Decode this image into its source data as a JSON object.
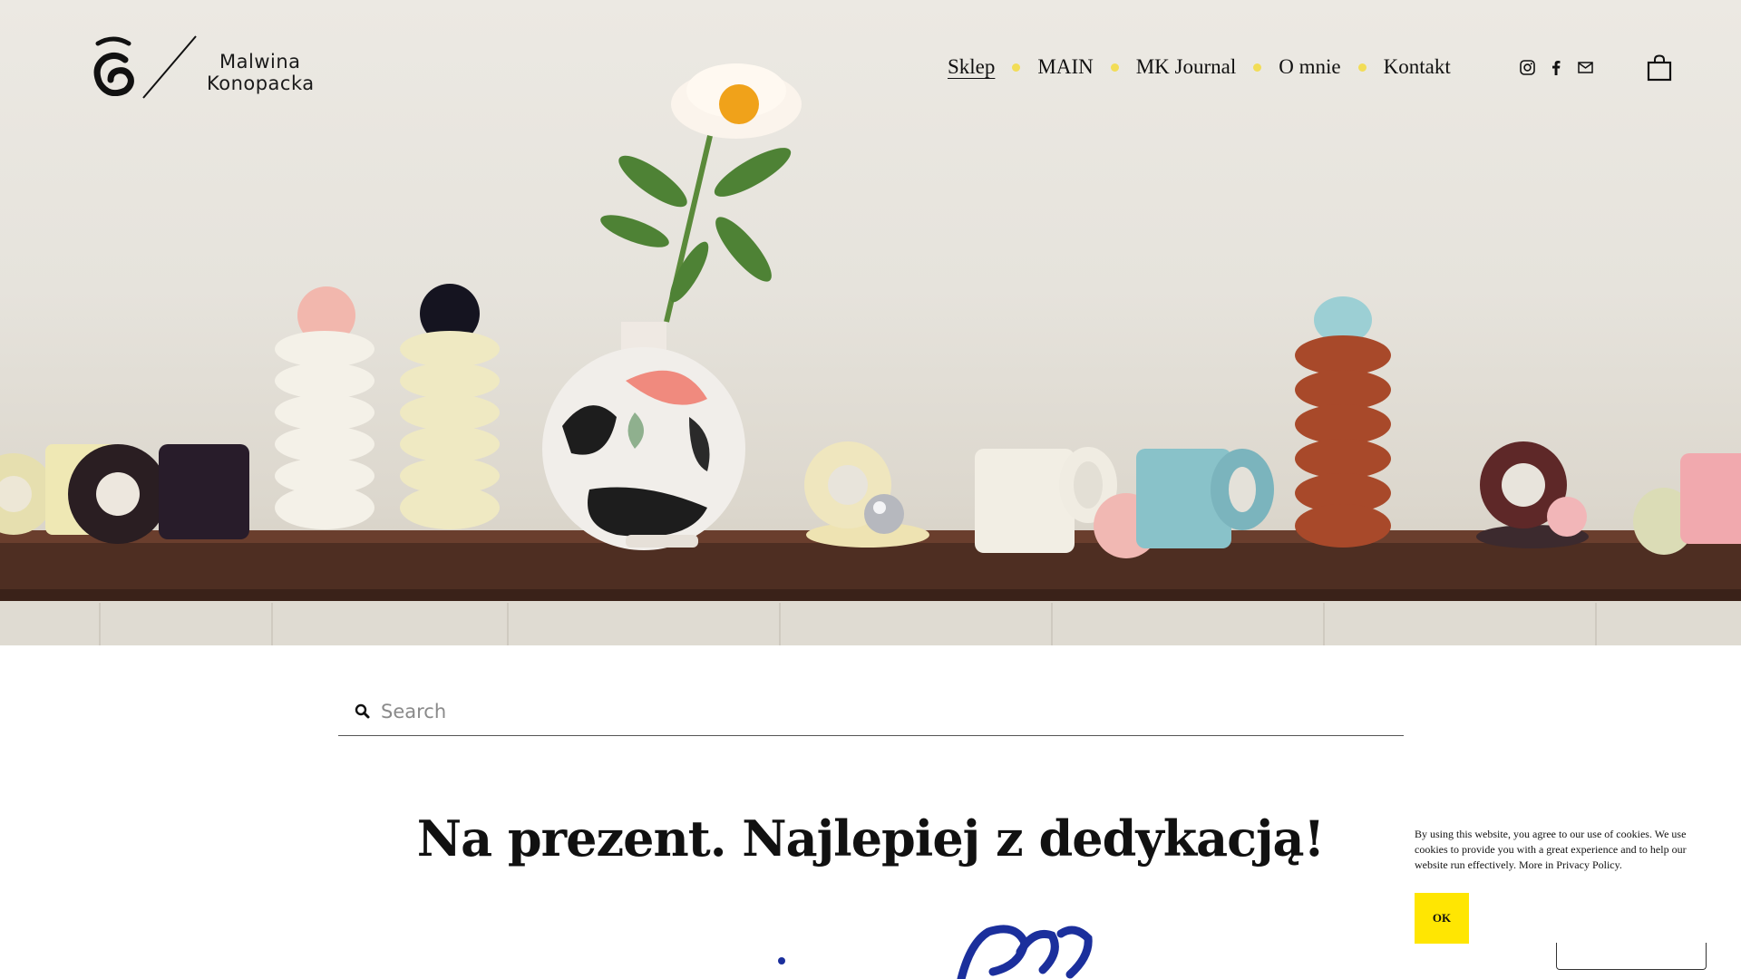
{
  "brand": {
    "line1": "Malwina",
    "line2": "Konopacka"
  },
  "nav": {
    "items": [
      {
        "label": "Sklep",
        "active": true
      },
      {
        "label": "MAIN"
      },
      {
        "label": "MK Journal"
      },
      {
        "label": "O mnie"
      },
      {
        "label": "Kontakt"
      }
    ]
  },
  "social": {
    "icons": [
      "instagram-icon",
      "facebook-icon",
      "mail-icon"
    ]
  },
  "cart": {
    "icon": "shopping-bag-icon"
  },
  "search": {
    "placeholder": "Search",
    "value": ""
  },
  "main": {
    "headline": "Na prezent. Najlepiej z dedykacją!"
  },
  "cookie": {
    "text": "By using this website, you agree to our use of cookies. We use cookies to provide you with a great experience and to help our website run effectively. More in Privacy Policy.",
    "ok_label": "OK"
  },
  "colors": {
    "accent": "#f2dd57",
    "cookie_button": "#ffe602",
    "script_ink": "#1b2f9c"
  }
}
